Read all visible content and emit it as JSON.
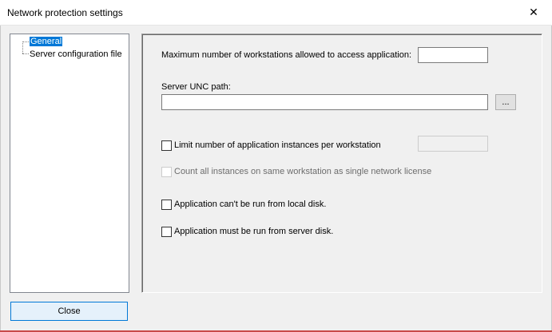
{
  "window": {
    "title": "Network protection settings",
    "close_glyph": "✕"
  },
  "tree": {
    "items": [
      {
        "label": "General",
        "selected": true
      },
      {
        "label": "Server configuration file",
        "selected": false
      }
    ]
  },
  "general": {
    "max_workstations_label": "Maximum number of workstations allowed to access application:",
    "max_workstations_value": "",
    "server_unc_label": "Server UNC path:",
    "server_unc_value": "",
    "browse_label": "...",
    "limit_instances_label": "Limit number of application instances per workstation",
    "limit_instances_checked": false,
    "limit_instances_value": "",
    "count_instances_label": "Count all instances on same workstation as single network license",
    "count_instances_checked": false,
    "no_local_disk_label": "Application can't be run from local disk.",
    "no_local_disk_checked": false,
    "must_server_disk_label": "Application must be run from server disk.",
    "must_server_disk_checked": false
  },
  "footer": {
    "close_label": "Close"
  }
}
